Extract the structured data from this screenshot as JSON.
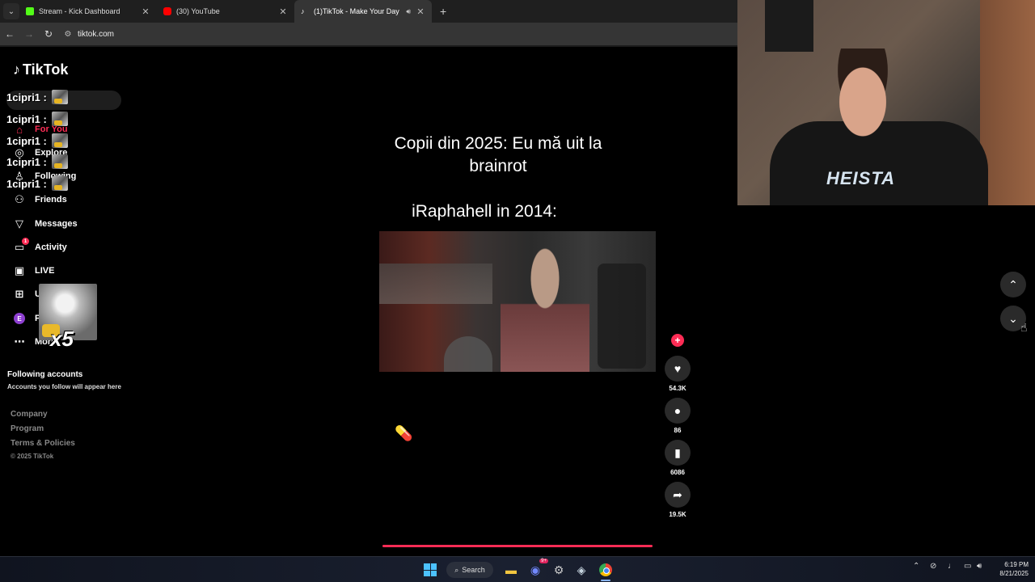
{
  "browser": {
    "tabs": [
      {
        "title": "Stream - Kick Dashboard",
        "favicon_color": "#53fc18"
      },
      {
        "title": "(30) YouTube",
        "favicon_color": "#ff0000"
      },
      {
        "title": "(1)TikTok - Make Your Day",
        "favicon_color": "#ffffff"
      }
    ],
    "url": "tiktok.com"
  },
  "sidebar": {
    "logo": "TikTok",
    "nav": [
      {
        "label": "For You",
        "icon": "home-icon"
      },
      {
        "label": "Explore",
        "icon": "compass-icon"
      },
      {
        "label": "Following",
        "icon": "following-icon"
      },
      {
        "label": "Friends",
        "icon": "friends-icon"
      },
      {
        "label": "Messages",
        "icon": "messages-icon"
      },
      {
        "label": "Activity",
        "icon": "activity-icon",
        "badge": "1"
      },
      {
        "label": "LIVE",
        "icon": "live-icon"
      },
      {
        "label": "U",
        "icon": "upload-icon"
      },
      {
        "label": "P",
        "icon": "profile-icon",
        "avatar": "E"
      },
      {
        "label": "More",
        "icon": "more-icon"
      }
    ],
    "following_accounts_title": "Following accounts",
    "following_accounts_sub": "Accounts you follow will appear here",
    "footer": [
      "Company",
      "Program",
      "Terms & Policies"
    ],
    "copyright": "© 2025 TikTok"
  },
  "chat_overlay": {
    "lines": [
      "1cipri1 :",
      "1cipri1 :",
      "1cipri1 :",
      "1cipri1 :",
      "1cipri1 :"
    ],
    "combo": "x5"
  },
  "video": {
    "caption_top": "Copii din 2025: Eu mă uit la brainrot",
    "caption_bottom": "iRaphahell in 2014:",
    "sticker": "💊"
  },
  "actions": {
    "likes": "54.3K",
    "comments": "86",
    "saves": "6086",
    "shares": "19.5K"
  },
  "webcam": {
    "shirt_text": "HEISTA"
  },
  "taskbar": {
    "search_label": "Search",
    "discord_badge": "9+",
    "time": "6:19 PM",
    "date": "8/21/2025"
  },
  "colors": {
    "accent": "#fe2c55",
    "bg": "#000000"
  }
}
